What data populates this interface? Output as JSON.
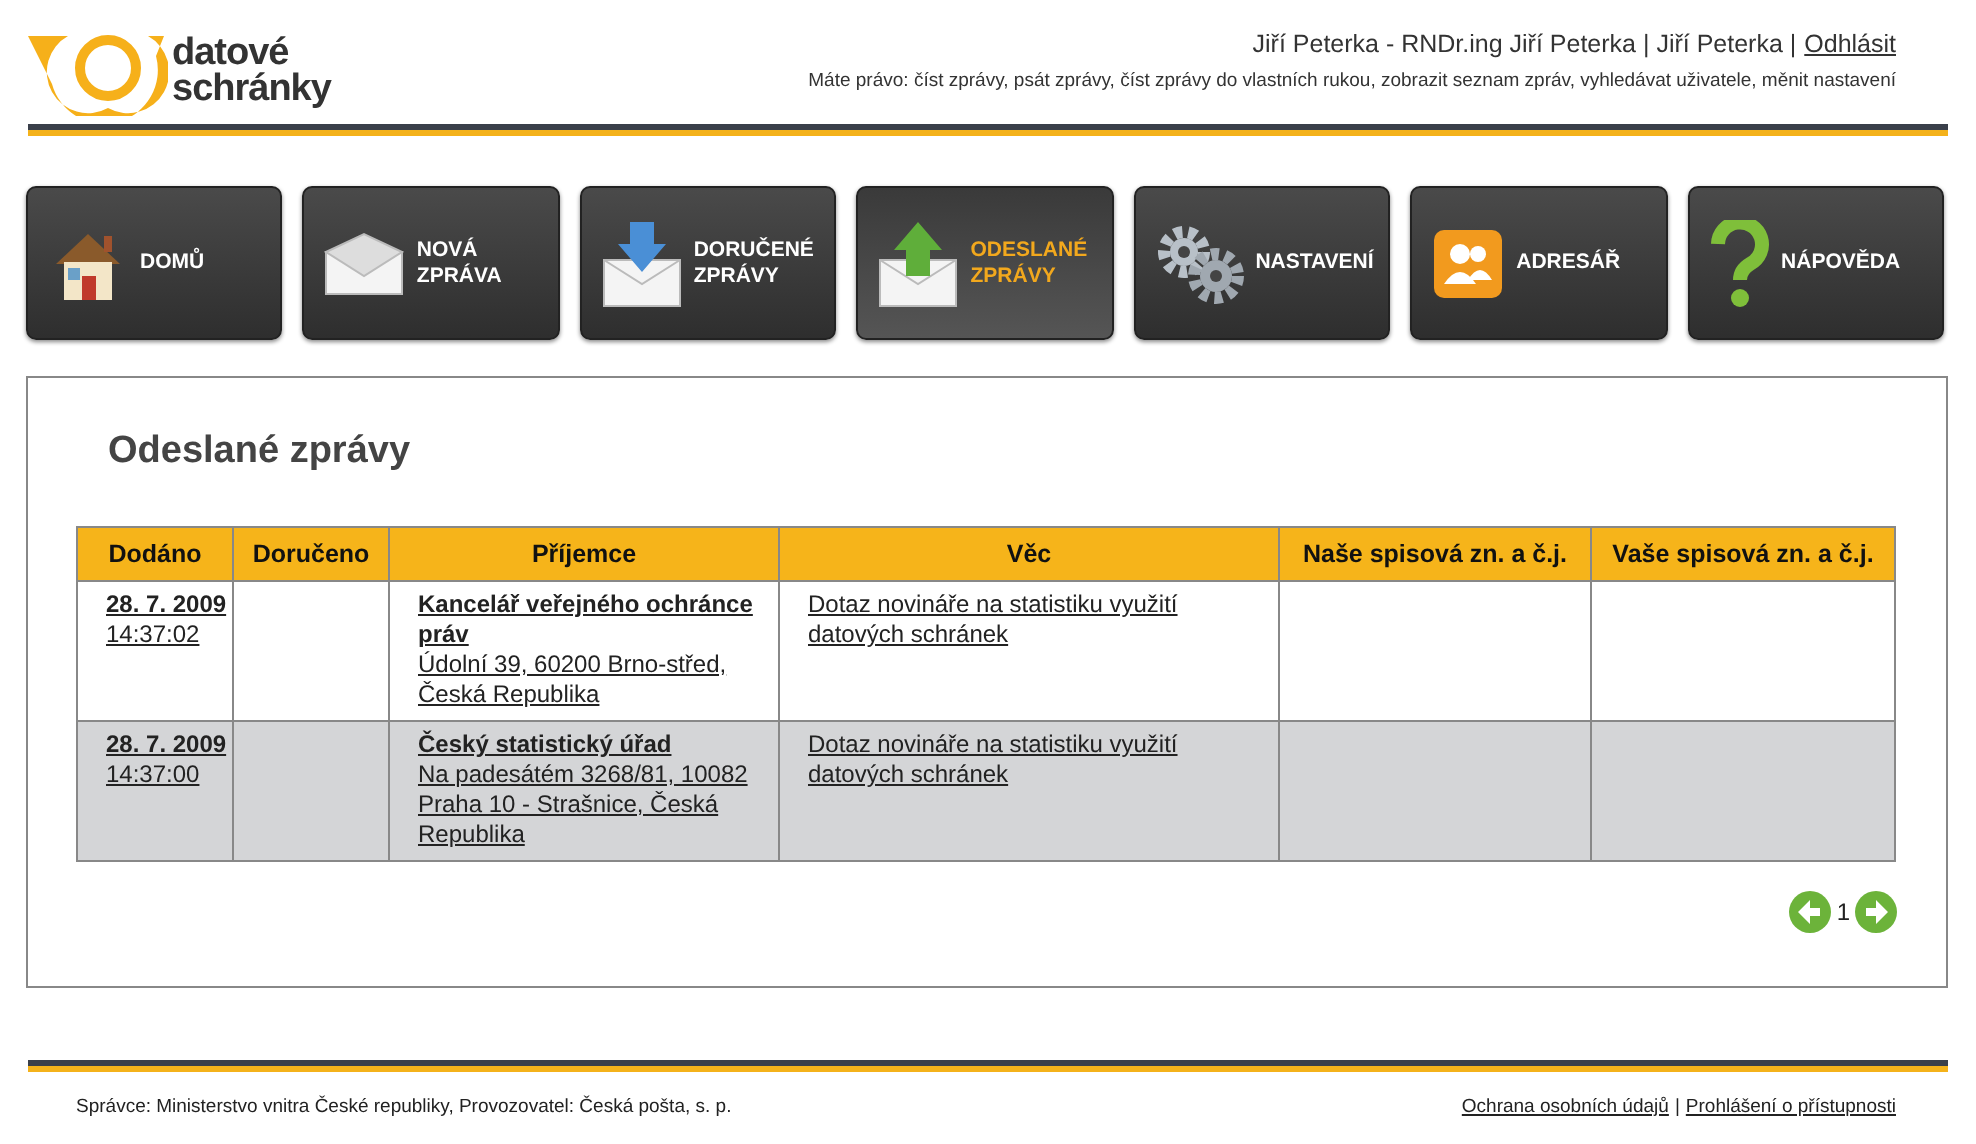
{
  "header": {
    "logo_line1": "datové",
    "logo_line2": "schránky",
    "user": "Jiří Peterka - RNDr.ing Jiří Peterka | Jiří Peterka |",
    "logout": "Odhlásit",
    "rights": "Máte právo: číst zprávy, psát zprávy, číst zprávy do vlastních rukou, zobrazit seznam zpráv, vyhledávat uživatele, měnit nastavení"
  },
  "tabs": [
    {
      "kind": "home",
      "label": "DOMŮ",
      "selected": false
    },
    {
      "kind": "new",
      "label": "NOVÁ ZPRÁVA",
      "selected": false
    },
    {
      "kind": "inbox",
      "label": "DORUČENÉ ZPRÁVY",
      "selected": false
    },
    {
      "kind": "sent",
      "label": "ODESLANÉ ZPRÁVY",
      "selected": true
    },
    {
      "kind": "settings",
      "label": "NASTAVENÍ",
      "selected": false
    },
    {
      "kind": "contacts",
      "label": "ADRESÁŘ",
      "selected": false
    },
    {
      "kind": "help",
      "label": "NÁPOVĚDA",
      "selected": false
    }
  ],
  "page_title": "Odeslané zprávy",
  "table": {
    "columns": [
      "Dodáno",
      "Doručeno",
      "Příjemce",
      "Věc",
      "Naše spisová zn. a č.j.",
      "Vaše spisová zn. a č.j."
    ],
    "rows": [
      {
        "date": "28. 7. 2009",
        "time": "14:37:02",
        "recipient": "Kancelář veřejného ochránce práv",
        "address": "Údolní 39, 60200 Brno-střed, Česká Republika",
        "subject": "Dotaz novináře na statistiku využití datových schránek"
      },
      {
        "date": "28. 7. 2009",
        "time": "14:37:00",
        "recipient": "Český statistický úřad",
        "address": "Na padesátém 3268/81, 10082 Praha 10 - Strašnice, Česká Republika",
        "subject": "Dotaz novináře na statistiku využití datových schránek"
      }
    ]
  },
  "pagination": {
    "page": "1"
  },
  "footer": {
    "text": "Správce: Ministerstvo vnitra České republiky, Provozovatel: Česká pošta, s. p.",
    "links": [
      "Ochrana osobních údajů",
      "Prohlášení o přístupnosti"
    ],
    "separator": "|"
  }
}
